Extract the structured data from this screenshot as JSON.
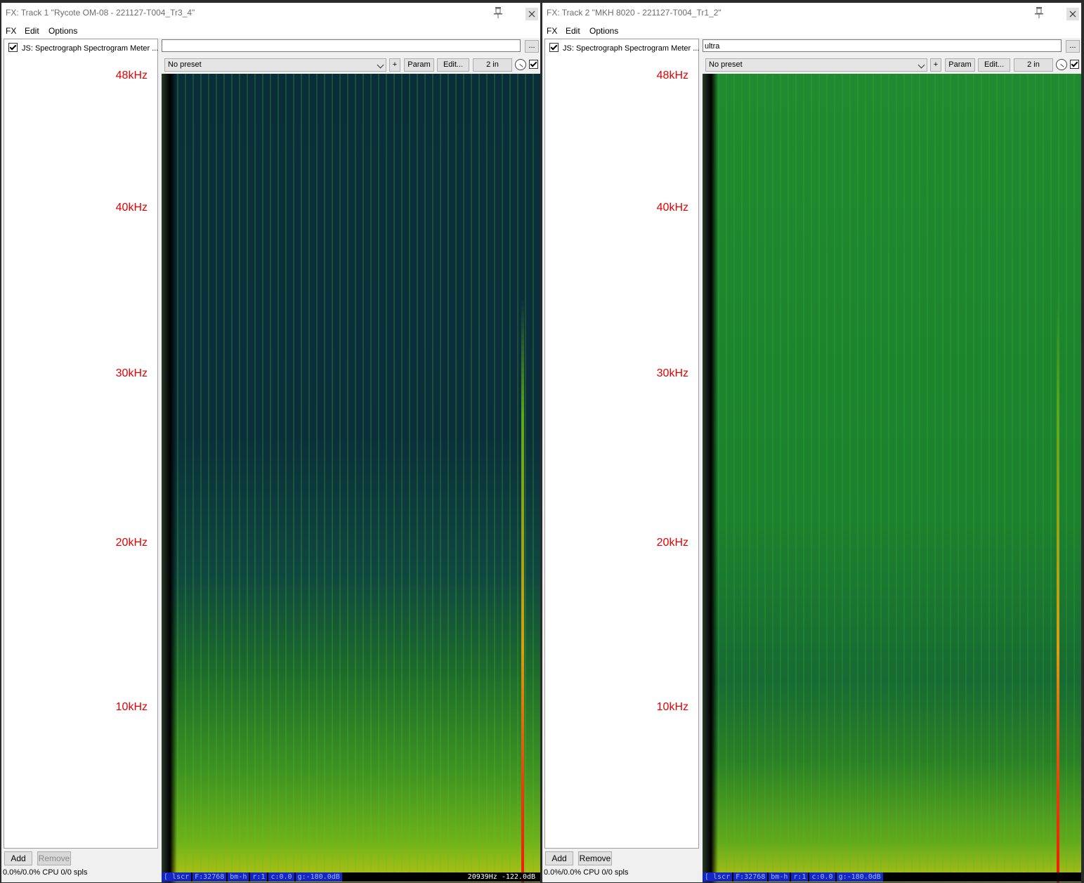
{
  "windows": [
    {
      "title": "FX: Track 1 \"Rycote OM-08 - 221127-T004_Tr3_4\"",
      "menu": [
        "FX",
        "Edit",
        "Options"
      ],
      "fx_item": "JS: Spectrograph Spectrogram Meter ...",
      "preset_name": "",
      "browse_label": "...",
      "preset_select": "No preset",
      "plus_label": "+",
      "param_label": "Param",
      "edit_label": "Edit...",
      "io_label": "2 in",
      "freq_labels": [
        "48kHz",
        "40kHz",
        "30kHz",
        "20kHz",
        "10kHz"
      ],
      "add_label": "Add",
      "remove_label": "Remove",
      "cpu": "0.0%/0.0% CPU 0/0 spls",
      "status": {
        "segments": [
          "[ lscr",
          "F:32768",
          "bm-h",
          "r:1",
          "c:0.0",
          "g:-180.0dB"
        ],
        "readout": "20939Hz -122.0dB"
      },
      "spectrogram_style": "dark"
    },
    {
      "title": "FX: Track 2 \"MKH 8020 - 221127-T004_Tr1_2\"",
      "menu": [
        "FX",
        "Edit",
        "Options"
      ],
      "fx_item": "JS: Spectrograph Spectrogram Meter ...",
      "preset_name": "ultra",
      "browse_label": "...",
      "preset_select": "No preset",
      "plus_label": "+",
      "param_label": "Param",
      "edit_label": "Edit...",
      "io_label": "2 in",
      "freq_labels": [
        "48kHz",
        "40kHz",
        "30kHz",
        "20kHz",
        "10kHz"
      ],
      "add_label": "Add",
      "remove_label": "Remove",
      "cpu": "0.0%/0.0% CPU 0/0 spls",
      "status": {
        "segments": [
          "[ lscr",
          "F:32768",
          "bm-h",
          "r:1",
          "c:0.0",
          "g:-180.0dB"
        ],
        "readout": ""
      },
      "spectrogram_style": "green"
    }
  ],
  "colors": {
    "freq_label": "#e60000",
    "status_segment_bg": "#1426c4",
    "spectrogram_dark_bg": "#0a2d3a",
    "spectrogram_green_bg": "#1f8a2f"
  },
  "icons": [
    "pin-icon",
    "close-icon",
    "checkbox-icon",
    "chevron-down-icon",
    "knob-icon"
  ]
}
